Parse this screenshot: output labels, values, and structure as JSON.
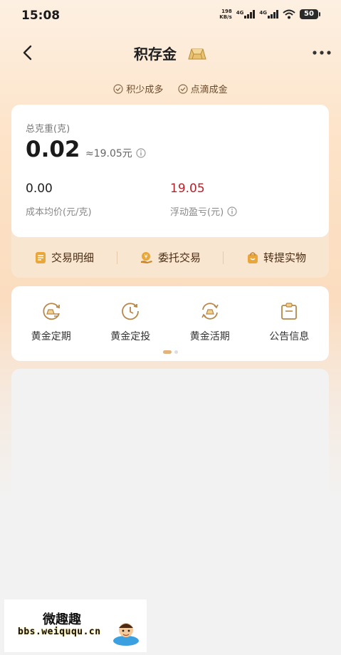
{
  "status_bar": {
    "time": "15:08",
    "speed_value": "198",
    "speed_unit": "KB/s",
    "network_1": "4G",
    "network_2": "4G",
    "battery": "50"
  },
  "nav": {
    "title": "积存金"
  },
  "slogans": [
    "积少成多",
    "点滴成金"
  ],
  "summary": {
    "total_weight_label": "总克重(克)",
    "total_weight_value": "0.02",
    "approx_value": "≈19.05元",
    "cost_value": "0.00",
    "cost_label": "成本均价(元/克)",
    "float_value": "19.05",
    "float_label": "浮动盈亏(元)"
  },
  "actions": [
    {
      "label": "交易明细",
      "icon": "document-list-icon"
    },
    {
      "label": "委托交易",
      "icon": "hand-coin-icon"
    },
    {
      "label": "转提实物",
      "icon": "shopping-bag-icon"
    }
  ],
  "quick_menu": [
    {
      "label": "黄金定期",
      "icon": "gold-cycle-icon"
    },
    {
      "label": "黄金定投",
      "icon": "clock-cycle-icon"
    },
    {
      "label": "黄金活期",
      "icon": "gold-refresh-icon"
    },
    {
      "label": "公告信息",
      "icon": "clipboard-icon"
    }
  ],
  "carousel": {
    "page": 1,
    "total": 2
  },
  "watermark": {
    "name": "微趣趣",
    "url": "bbs.weiququ.cn"
  },
  "colors": {
    "accent_gold": "#e2b47c",
    "profit_red": "#b3232c",
    "action_text": "#4a2b12"
  }
}
